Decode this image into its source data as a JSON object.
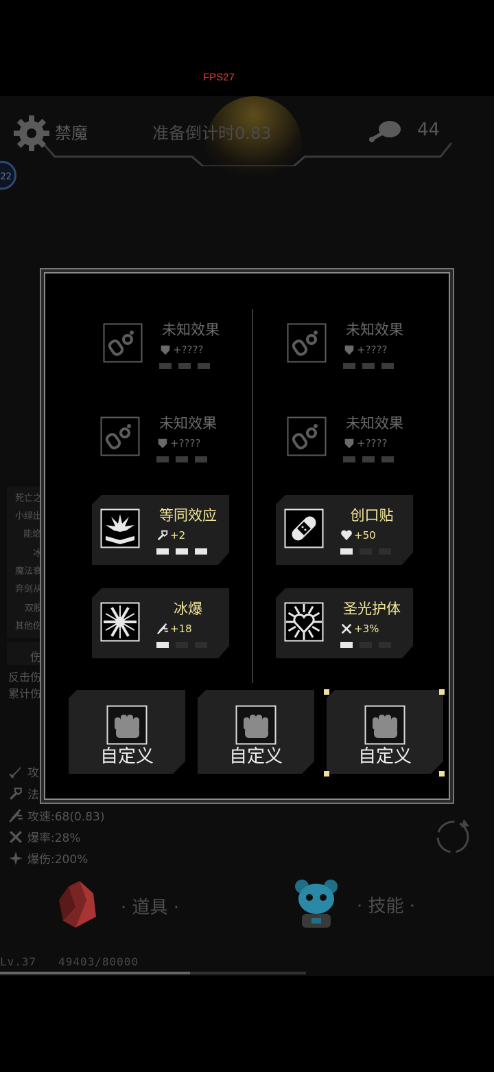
{
  "fps": "FPS27",
  "header": {
    "mode": "禁魔",
    "countdown": "准备倒计时0.83",
    "meat_count": "44",
    "level_badge": "22"
  },
  "side_list": [
    "死亡之",
    "小绿出",
    "能焰",
    "冰",
    "魔法衰",
    "弃剑从",
    "双股",
    "其他伤"
  ],
  "side_extra": [
    "伤",
    "反击伤",
    "累计伤"
  ],
  "stats": [
    {
      "icon": "sword-icon",
      "text": "攻"
    },
    {
      "icon": "wand-icon",
      "text": "法"
    },
    {
      "icon": "attack-speed-icon",
      "text": "攻速:68(0.83)"
    },
    {
      "icon": "crit-rate-icon",
      "text": "爆率:28%"
    },
    {
      "icon": "crit-damage-icon",
      "text": "爆伤:200%"
    }
  ],
  "tabs": {
    "items": "· 道具 ·",
    "skills": "· 技能 ·"
  },
  "level": {
    "label": "Lv.37",
    "xp": "49403/80000",
    "progress": 0.62
  },
  "modal": {
    "cards": [
      {
        "name": "未知效果",
        "stat": "+????",
        "stat_icon": "shield-icon",
        "pips": 0,
        "locked": true
      },
      {
        "name": "未知效果",
        "stat": "+????",
        "stat_icon": "shield-icon",
        "pips": 0,
        "locked": true
      },
      {
        "name": "未知效果",
        "stat": "+????",
        "stat_icon": "shield-icon",
        "pips": 0,
        "locked": true
      },
      {
        "name": "未知效果",
        "stat": "+????",
        "stat_icon": "shield-icon",
        "pips": 0,
        "locked": true
      },
      {
        "name": "等同效应",
        "stat": "+2",
        "stat_icon": "wand-icon",
        "pips": 3,
        "locked": false
      },
      {
        "name": "创口贴",
        "stat": "+50",
        "stat_icon": "heart-icon",
        "pips": 1,
        "locked": false
      },
      {
        "name": "冰爆",
        "stat": "+18",
        "stat_icon": "attack-speed-icon",
        "pips": 1,
        "locked": false
      },
      {
        "name": "圣光护体",
        "stat": "+3%",
        "stat_icon": "crit-rate-icon",
        "pips": 1,
        "locked": false
      }
    ],
    "custom_label": "自定义"
  },
  "colors": {
    "accent_yellow": "#f3e89a",
    "fps_red": "#e0413b",
    "locked_gray": "#6a6a6a"
  }
}
